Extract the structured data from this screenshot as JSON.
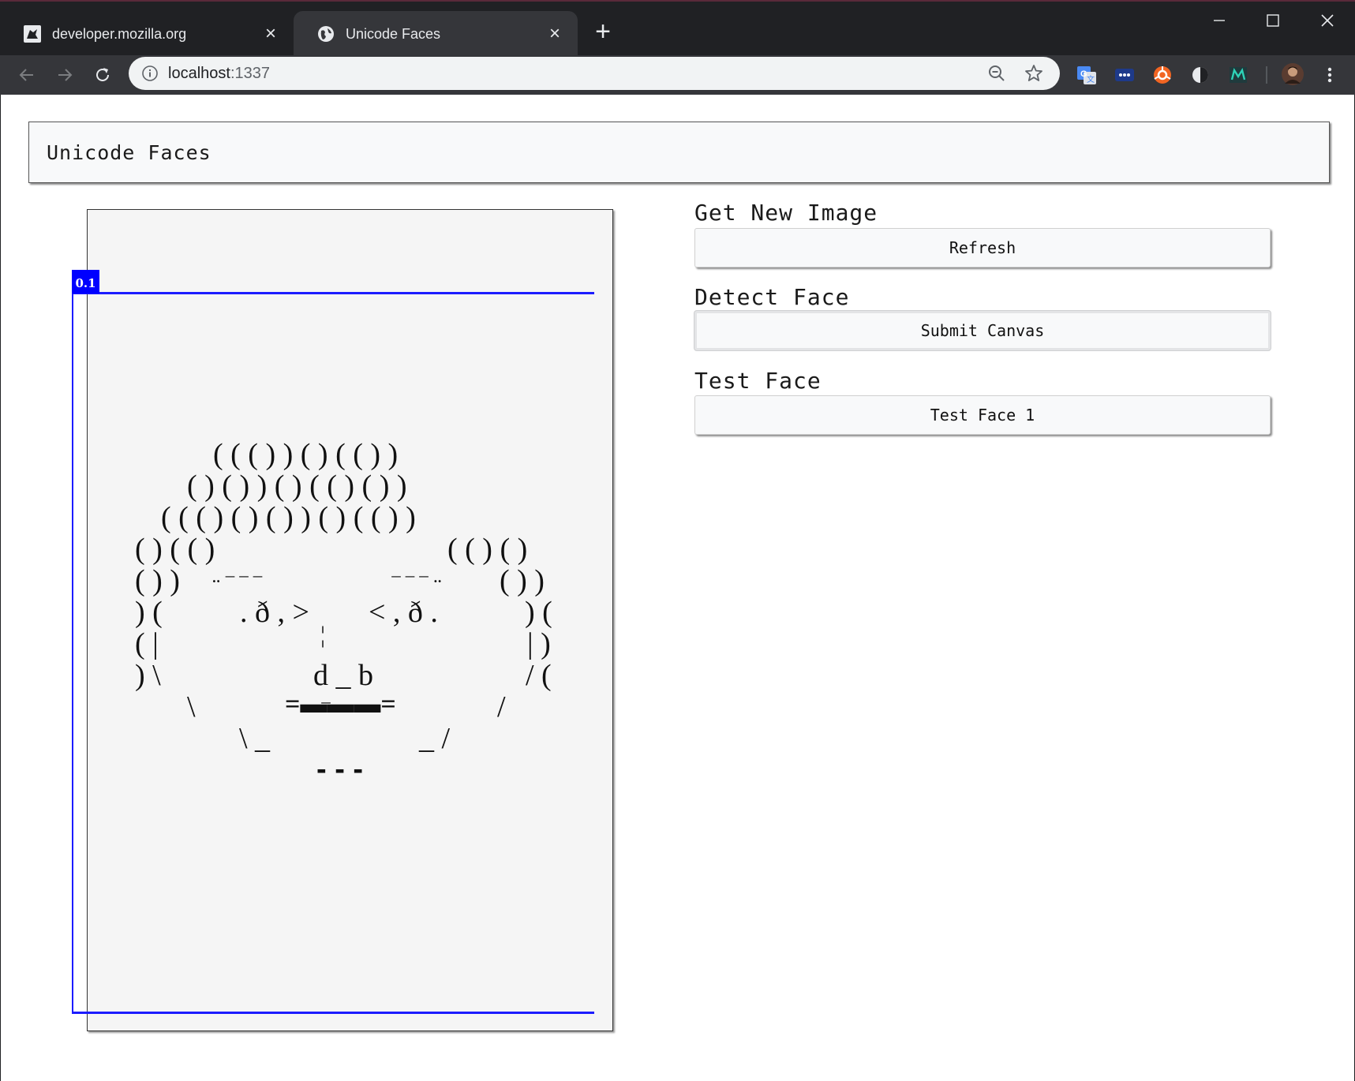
{
  "browser": {
    "tabs": [
      {
        "title": "developer.mozilla.org",
        "active": false,
        "favicon": "mdn-dino-icon"
      },
      {
        "title": "Unicode Faces",
        "active": true,
        "favicon": "globe-icon"
      }
    ],
    "address": {
      "host": "localhost",
      "port": ":1337"
    },
    "extensions": [
      "google-translate-icon",
      "dots-extension-icon",
      "orange-circle-extension-icon",
      "contrast-extension-icon",
      "m-extension-icon",
      "profile-avatar-icon"
    ]
  },
  "page": {
    "header": "Unicode Faces",
    "sections": [
      {
        "label": "Get New Image",
        "button": "Refresh"
      },
      {
        "label": "Detect Face",
        "button": "Submit Canvas"
      },
      {
        "label": "Test Face",
        "button": "Test Face 1"
      }
    ],
    "detection": {
      "score": "0.1",
      "box_color": "#1c1cff"
    },
    "ascii_face": [
      "( ( ( ) ) ( ) ( ( ) )",
      "( ) ( ) ) ( ) ( ( ) ( ) )",
      "( ( ( ) ( ) ( ) ) ( ) ( ( ) )",
      "( ) ( ( )",
      "( ( ) ( )",
      "( ) )",
      "( ) )",
      "¨ ‾ ‾ ‾",
      "‾ ‾ ‾ ¨",
      ") (",
      ". ð , >",
      "< , ð .",
      ") (",
      "¦",
      "( |",
      "| )",
      ") \\",
      "d _ b",
      "/ (",
      "\\",
      "=▬▬▬=",
      "/",
      "‾",
      "\\ _",
      "_ /",
      "- - -"
    ]
  }
}
